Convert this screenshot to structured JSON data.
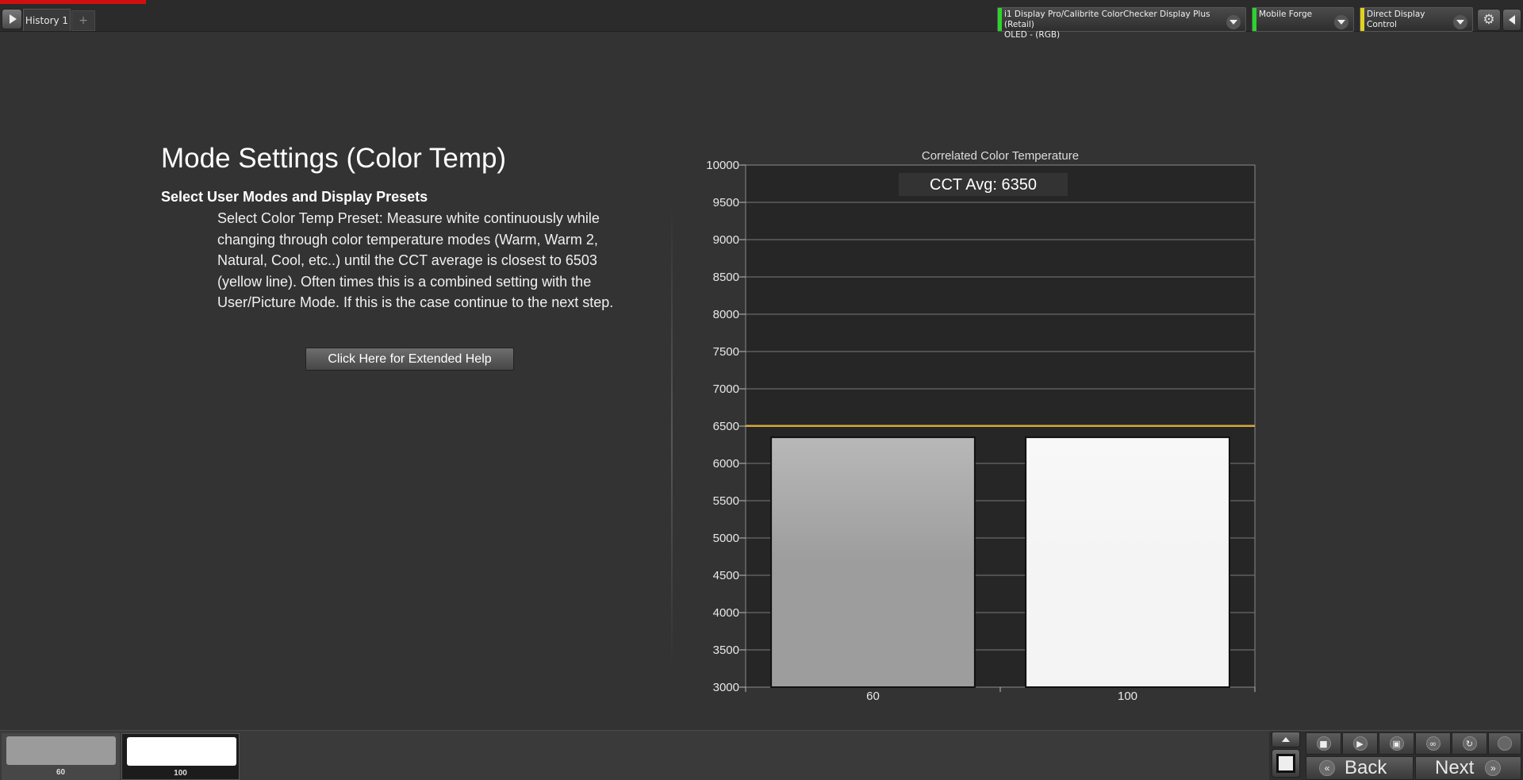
{
  "header": {
    "history_tab": "History 1",
    "add_tab": "+",
    "devices": [
      {
        "line1": "i1 Display Pro/Calibrite ColorChecker Display Plus (Retail)",
        "line2": "OLED - (RGB)",
        "status_color": "#2bd42b"
      },
      {
        "line1": "Mobile Forge",
        "line2": "",
        "status_color": "#2bd42b"
      },
      {
        "line1": "Direct Display Control",
        "line2": "",
        "status_color": "#e0d020"
      }
    ],
    "settings_icon": "gear-icon"
  },
  "content": {
    "title": "Mode Settings (Color Temp)",
    "section_title": "Select User Modes and Display Presets",
    "instructions": "Select Color Temp Preset: Measure white continuously while changing through color temperature modes (Warm, Warm 2, Natural, Cool, etc..) until the CCT average is closest to 6503 (yellow line). Often times this is a combined setting with the User/Picture Mode. If this is the case continue to the next step.",
    "help_button": "Click Here for Extended Help"
  },
  "chart_data": {
    "type": "bar",
    "title": "Correlated Color Temperature",
    "annotation": "CCT Avg: 6350",
    "categories": [
      "60",
      "100"
    ],
    "values": [
      6350,
      6350
    ],
    "bar_colors": [
      "#9d9d9d",
      "#f4f4f4"
    ],
    "reference_line": 6503,
    "reference_color": "#d4a93a",
    "ylim": [
      3000,
      10000
    ],
    "yticks": [
      "3000",
      "3500",
      "4000",
      "4500",
      "5000",
      "5500",
      "6000",
      "6500",
      "7000",
      "7500",
      "8000",
      "8500",
      "9000",
      "9500",
      "10000"
    ],
    "grid": true,
    "xlabel": "",
    "ylabel": ""
  },
  "footer": {
    "swatches": [
      {
        "label": "60",
        "color": "#9b9b9b"
      },
      {
        "label": "100",
        "color": "#ffffff"
      }
    ],
    "back_label": "Back",
    "next_label": "Next"
  }
}
